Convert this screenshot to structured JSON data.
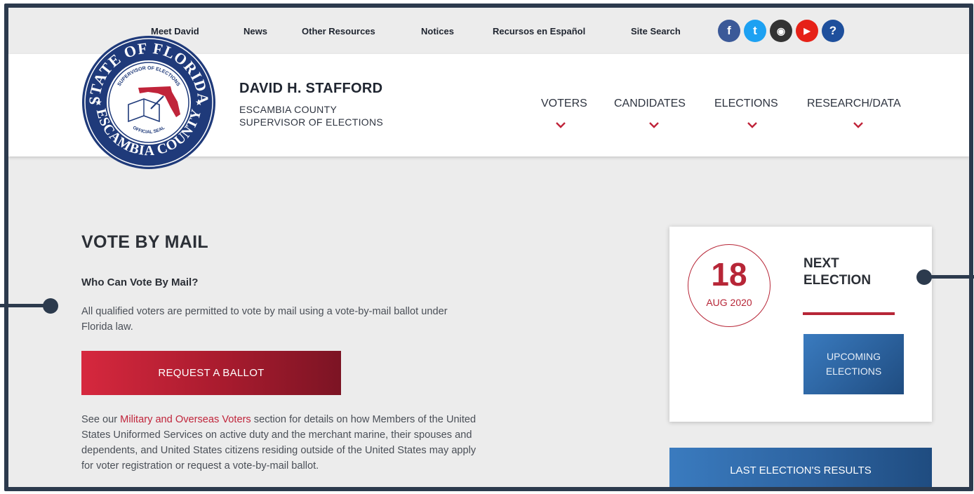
{
  "utility_nav": [
    "Meet David",
    "News",
    "Other Resources",
    "Notices",
    "Recursos en Español",
    "Site Search"
  ],
  "social_icons": [
    {
      "name": "facebook-icon",
      "glyph": "f",
      "color": "#3b5998"
    },
    {
      "name": "twitter-icon",
      "glyph": "t",
      "color": "#1da1f2"
    },
    {
      "name": "instagram-icon",
      "glyph": "◉",
      "color": "#333333"
    },
    {
      "name": "youtube-icon",
      "glyph": "▶",
      "color": "#e62117"
    },
    {
      "name": "help-icon",
      "glyph": "?",
      "color": "#1e4f9c"
    }
  ],
  "seal": {
    "top_text": "STATE OF FLORIDA",
    "bottom_text": "ESCAMBIA COUNTY",
    "inner_top": "SUPERVISOR OF ELECTIONS",
    "inner_bottom": "OFFICIAL SEAL"
  },
  "brand": {
    "name": "DAVID H. STAFFORD",
    "line1": "ESCAMBIA COUNTY",
    "line2": "SUPERVISOR OF ELECTIONS"
  },
  "main_nav": [
    "VOTERS",
    "CANDIDATES",
    "ELECTIONS",
    "RESEARCH/DATA"
  ],
  "content": {
    "title": "VOTE BY MAIL",
    "question": "Who Can Vote By Mail?",
    "para1_line1": "All qualified voters are permitted to vote by mail using a vote-by-mail ballot under",
    "para1_line2": "Florida law.",
    "request_button": "REQUEST A BALLOT",
    "para2_prefix": "See our ",
    "para2_link": "Military and Overseas Voters",
    "para2_line1_suffix": " section for details on how Members of the United",
    "para2_line2": "States Uniformed Services on active duty and the merchant marine, their spouses and",
    "para2_line3": "dependents, and United States citizens residing outside of the United States may apply",
    "para2_line4": "for voter registration or request a vote-by-mail ballot."
  },
  "next_election": {
    "day": "18",
    "month_year": "AUG 2020",
    "label_line1": "NEXT",
    "label_line2": "ELECTION",
    "upcoming_line1": "UPCOMING",
    "upcoming_line2": "ELECTIONS"
  },
  "last_results_button": "LAST ELECTION'S RESULTS",
  "colors": {
    "frame": "#2c3a4d",
    "accent_red": "#b72637",
    "accent_blue": "#2a5f9a",
    "background": "#ececec"
  }
}
